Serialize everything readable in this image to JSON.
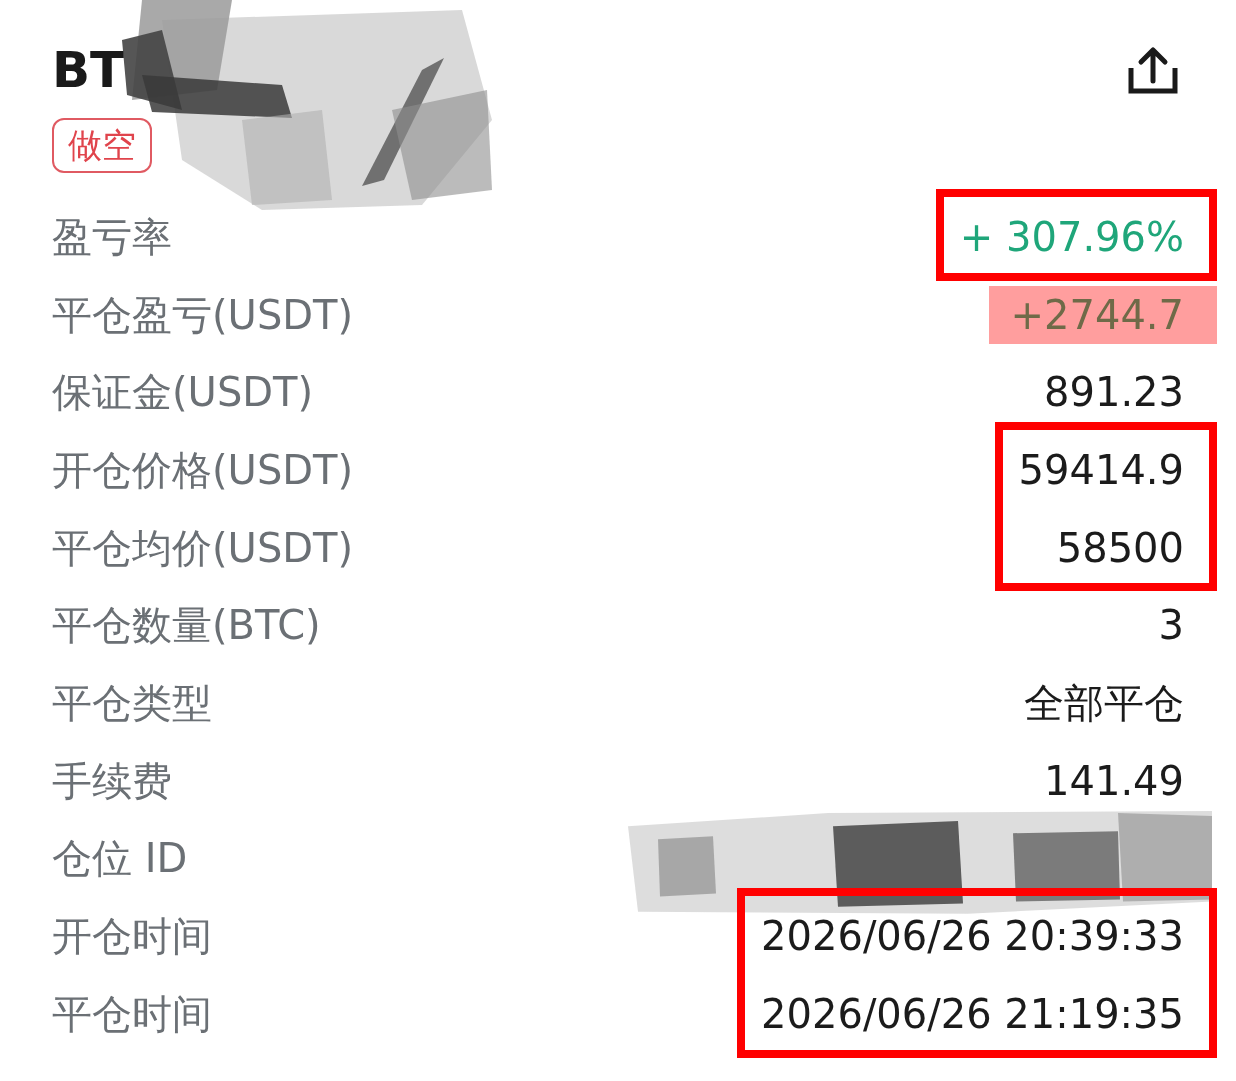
{
  "header": {
    "title": "BT",
    "redacted": true,
    "tag": "做空"
  },
  "sections": [
    {
      "framed": true,
      "rows": [
        {
          "label": "盈亏率",
          "value": "+ 307.96%",
          "kind": "profit"
        }
      ]
    },
    {
      "framed": false,
      "rows": [
        {
          "label": "平仓盈亏(USDT)",
          "value": "+2744.7",
          "kind": "highlighted"
        },
        {
          "label": "保证金(USDT)",
          "value": "891.23",
          "kind": "plain"
        }
      ]
    },
    {
      "framed": true,
      "rows": [
        {
          "label": "开仓价格(USDT)",
          "value": "59414.9",
          "kind": "plain"
        },
        {
          "label": "平仓均价(USDT)",
          "value": "58500",
          "kind": "plain"
        }
      ]
    },
    {
      "framed": false,
      "rows": [
        {
          "label": "平仓数量(BTC)",
          "value": "3",
          "kind": "plain"
        },
        {
          "label": "平仓类型",
          "value": "全部平仓",
          "kind": "plain"
        },
        {
          "label": "手续费",
          "value": "141.49",
          "kind": "plain"
        },
        {
          "label": "仓位 ID",
          "redacted": true
        }
      ]
    },
    {
      "framed": true,
      "rows": [
        {
          "label": "开仓时间",
          "value": "2026/06/26 20:39:33",
          "kind": "plain"
        },
        {
          "label": "平仓时间",
          "value": "2026/06/26 21:19:35",
          "kind": "plain"
        }
      ]
    }
  ]
}
